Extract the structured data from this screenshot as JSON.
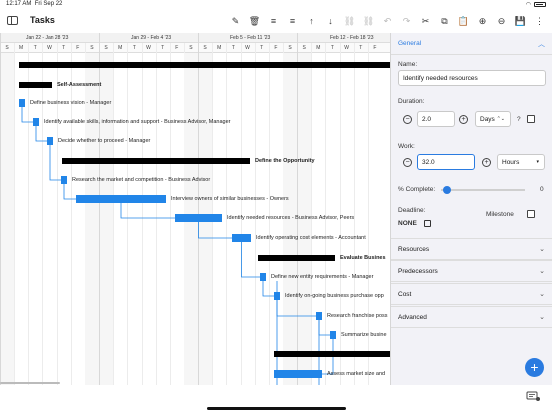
{
  "status": {
    "time": "12:17 AM",
    "date": "Fri Sep 22"
  },
  "header": {
    "title": "Tasks"
  },
  "toolbar": {
    "icons": [
      "pencil-icon",
      "trash-icon",
      "indent-icon",
      "outdent-icon",
      "arrow-up-icon",
      "arrow-down-icon",
      "link-icon",
      "unlink-icon",
      "undo-icon",
      "redo-icon",
      "scissors-icon",
      "copy-icon",
      "paste-icon",
      "zoom-in-icon",
      "zoom-out-icon",
      "save-icon",
      "more-icon"
    ],
    "glyphs": [
      "✎",
      "🗑",
      "≡",
      "≡",
      "↑",
      "↓",
      "⛓",
      "⛓",
      "↶",
      "↷",
      "✂",
      "⧉",
      "📋",
      "⊕",
      "⊖",
      "💾",
      "⋮"
    ]
  },
  "timeline": {
    "weeks": [
      "Jan 22 - Jan 28 '23",
      "Jan 29 - Feb 4 '23",
      "Feb 5 - Feb 11 '23",
      "Feb 12 - Feb 18 '23"
    ],
    "days": [
      "S",
      "M",
      "T",
      "W",
      "T",
      "F",
      "S",
      "S",
      "M",
      "T",
      "W",
      "T",
      "F",
      "S",
      "S",
      "M",
      "T",
      "W",
      "T",
      "F",
      "S",
      "S",
      "M",
      "T",
      "W",
      "T",
      "F"
    ]
  },
  "tasks": [
    {
      "name": "Self-Assessment",
      "bold": true
    },
    {
      "name": "Define business vision - Manager"
    },
    {
      "name": "Identify available skills, information and support - Business Advisor, Manager"
    },
    {
      "name": "Decide whether to proceed - Manager"
    },
    {
      "name": "Define the Opportunity",
      "bold": true
    },
    {
      "name": "Research the market and competition - Business Advisor"
    },
    {
      "name": "Interview owners of similar businesses - Owners"
    },
    {
      "name": "Identify needed resources - Business Advisor, Peers"
    },
    {
      "name": "Identify operating cost elements - Accountant"
    },
    {
      "name": "Evaluate Busines",
      "bold": true
    },
    {
      "name": "Define new entity requirements - Manager"
    },
    {
      "name": "Identify on-going business purchase opp"
    },
    {
      "name": "Research franchise poss"
    },
    {
      "name": "Summarize busine"
    },
    {
      "name": "Assess market size and"
    }
  ],
  "panel": {
    "general": "General",
    "name_label": "Name:",
    "name_value": "Identify needed resources",
    "duration_label": "Duration:",
    "duration_value": "2.0",
    "duration_unit": "Days",
    "question": "?",
    "work_label": "Work:",
    "work_value": "32.0",
    "work_unit": "Hours",
    "complete_label": "% Complete:",
    "complete_value": "0",
    "deadline_label": "Deadline:",
    "deadline_value": "NONE",
    "milestone_label": "Milestone",
    "sections": [
      "Resources",
      "Predecessors",
      "Cost",
      "Advanced"
    ]
  },
  "fab_label": "+"
}
